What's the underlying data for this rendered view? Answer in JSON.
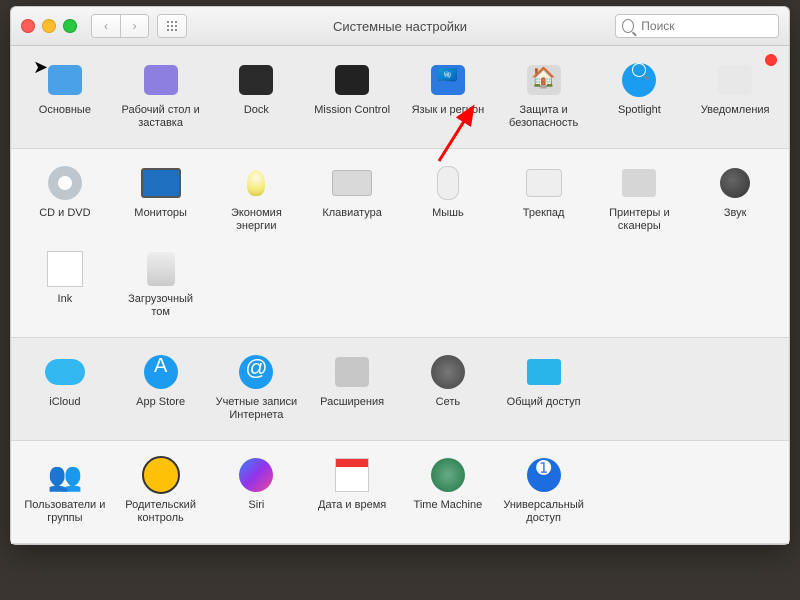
{
  "window": {
    "title": "Системные настройки",
    "search_placeholder": "Поиск"
  },
  "rows": [
    {
      "alt": false,
      "items": [
        {
          "id": "general",
          "label": "Основные"
        },
        {
          "id": "desktop",
          "label": "Рабочий стол и заставка"
        },
        {
          "id": "dock",
          "label": "Dock"
        },
        {
          "id": "mission",
          "label": "Mission Control"
        },
        {
          "id": "lang",
          "label": "Язык и регион"
        },
        {
          "id": "security",
          "label": "Защита и безопасность"
        },
        {
          "id": "spotlight",
          "label": "Spotlight"
        },
        {
          "id": "notif",
          "label": "Уведомления",
          "badge": true
        }
      ]
    },
    {
      "alt": true,
      "items": [
        {
          "id": "cddvd",
          "label": "CD и DVD"
        },
        {
          "id": "monitors",
          "label": "Мониторы"
        },
        {
          "id": "energy",
          "label": "Экономия энергии"
        },
        {
          "id": "keyboard",
          "label": "Клавиатура"
        },
        {
          "id": "mouse",
          "label": "Мышь"
        },
        {
          "id": "trackpad",
          "label": "Трекпад"
        },
        {
          "id": "printers",
          "label": "Принтеры и сканеры"
        },
        {
          "id": "sound",
          "label": "Звук"
        },
        {
          "id": "ink",
          "label": "Ink"
        },
        {
          "id": "startup",
          "label": "Загрузочный том"
        }
      ]
    },
    {
      "alt": false,
      "items": [
        {
          "id": "icloud",
          "label": "iCloud"
        },
        {
          "id": "appstore",
          "label": "App Store"
        },
        {
          "id": "iaccounts",
          "label": "Учетные записи Интернета"
        },
        {
          "id": "extensions",
          "label": "Расширения"
        },
        {
          "id": "network",
          "label": "Сеть"
        },
        {
          "id": "sharing",
          "label": "Общий доступ"
        }
      ]
    },
    {
      "alt": true,
      "items": [
        {
          "id": "users",
          "label": "Пользователи и группы"
        },
        {
          "id": "parental",
          "label": "Родительский контроль"
        },
        {
          "id": "siri",
          "label": "Siri"
        },
        {
          "id": "datetime",
          "label": "Дата и время"
        },
        {
          "id": "timemachine",
          "label": "Time Machine"
        },
        {
          "id": "accessibility",
          "label": "Универсальный доступ"
        }
      ]
    }
  ],
  "icons": {
    "general": "general-icon",
    "desktop": "desktop-icon",
    "dock": "dock-icon",
    "mission": "mission-control-icon",
    "lang": "language-region-icon",
    "security": "security-icon",
    "spotlight": "spotlight-icon",
    "notif": "notifications-icon",
    "cddvd": "cd-dvd-icon",
    "monitors": "displays-icon",
    "energy": "energy-saver-icon",
    "keyboard": "keyboard-icon",
    "mouse": "mouse-icon",
    "trackpad": "trackpad-icon",
    "printers": "printers-icon",
    "sound": "sound-icon",
    "ink": "ink-icon",
    "startup": "startup-disk-icon",
    "icloud": "icloud-icon",
    "appstore": "app-store-icon",
    "iaccounts": "internet-accounts-icon",
    "extensions": "extensions-icon",
    "network": "network-icon",
    "sharing": "sharing-icon",
    "users": "users-groups-icon",
    "parental": "parental-controls-icon",
    "siri": "siri-icon",
    "datetime": "date-time-icon",
    "timemachine": "time-machine-icon",
    "accessibility": "accessibility-icon"
  }
}
